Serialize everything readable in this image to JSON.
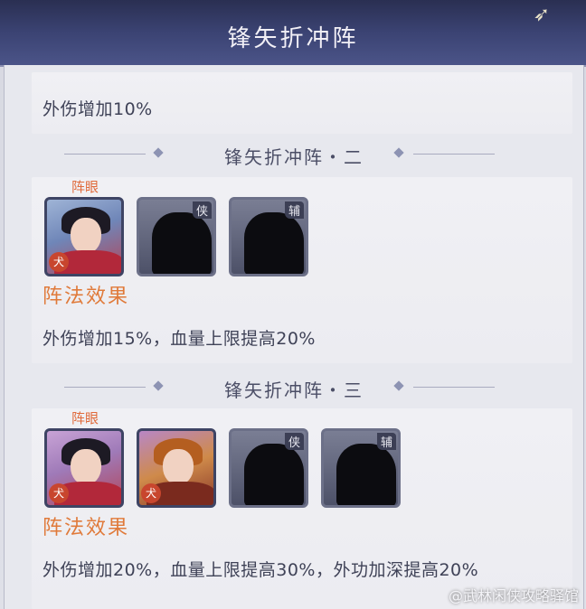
{
  "header": {
    "title": "锋矢折冲阵"
  },
  "section1": {
    "effect": "外伤增加10%"
  },
  "section2": {
    "title": "锋矢折冲阵・二",
    "eye_label": "阵眼",
    "slots": [
      {
        "type": "hero",
        "badge": "犬"
      },
      {
        "type": "locked",
        "tag": "侠"
      },
      {
        "type": "locked",
        "tag": "辅"
      }
    ],
    "effect_title": "阵法效果",
    "effect": "外伤增加15%，血量上限提高20%"
  },
  "section3": {
    "title": "锋矢折冲阵・三",
    "eye_label": "阵眼",
    "slots": [
      {
        "type": "hero",
        "badge": "犬"
      },
      {
        "type": "hero",
        "badge": "犬"
      },
      {
        "type": "locked",
        "tag": "侠"
      },
      {
        "type": "locked",
        "tag": "辅"
      }
    ],
    "effect_title": "阵法效果",
    "effect": "外伤增加20%，血量上限提高30%，外功加深提高20%"
  },
  "watermark": "@武林闲侠攻略驿馆",
  "icons": {
    "bird": "swallow-icon"
  }
}
